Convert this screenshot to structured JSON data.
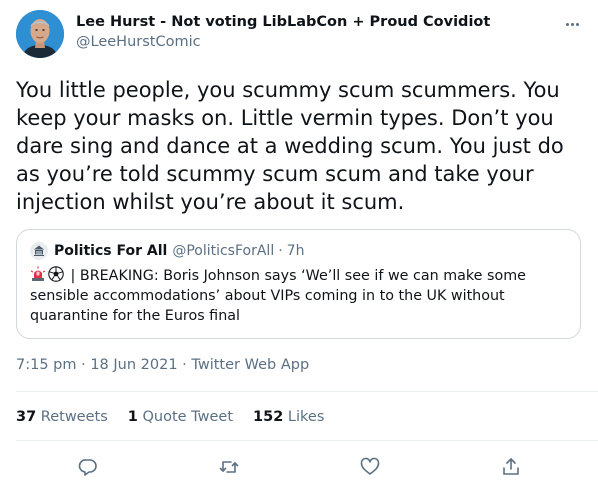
{
  "author": {
    "name": "Lee Hurst - Not voting LibLabCon + Proud Covidiot",
    "handle": "@LeeHurstComic"
  },
  "tweet": {
    "text": "You little people, you scummy scum scummers. You keep your masks on. Little vermin types. Don’t you dare sing and dance at a wedding scum. You just do as you’re told scummy scum scum and take your injection whilst you’re about it scum."
  },
  "quote": {
    "name": "Politics For All",
    "handle": "@PoliticsForAll",
    "separator": "·",
    "time": "7h",
    "emojis": [
      "police-light-icon",
      "soccer-ball-icon"
    ],
    "text": "| BREAKING: Boris Johnson says ‘We’ll see if we can make some sensible accommodations’ about VIPs coming in to the UK without quarantine for the Euros final"
  },
  "meta": {
    "time": "7:15 pm",
    "sep1": "·",
    "date": "18 Jun 2021",
    "sep2": "·",
    "source": "Twitter Web App"
  },
  "stats": {
    "retweets_count": "37",
    "retweets_label": "Retweets",
    "quotes_count": "1",
    "quotes_label": "Quote Tweet",
    "likes_count": "152",
    "likes_label": "Likes"
  },
  "actions": [
    "reply-icon",
    "retweet-icon",
    "like-icon",
    "share-icon"
  ],
  "colors": {
    "text": "#0f1419",
    "secondary": "#5b7083",
    "border": "#cfd9de",
    "divider": "#ebeef0",
    "avatar_bg": "#2f8fd3"
  }
}
